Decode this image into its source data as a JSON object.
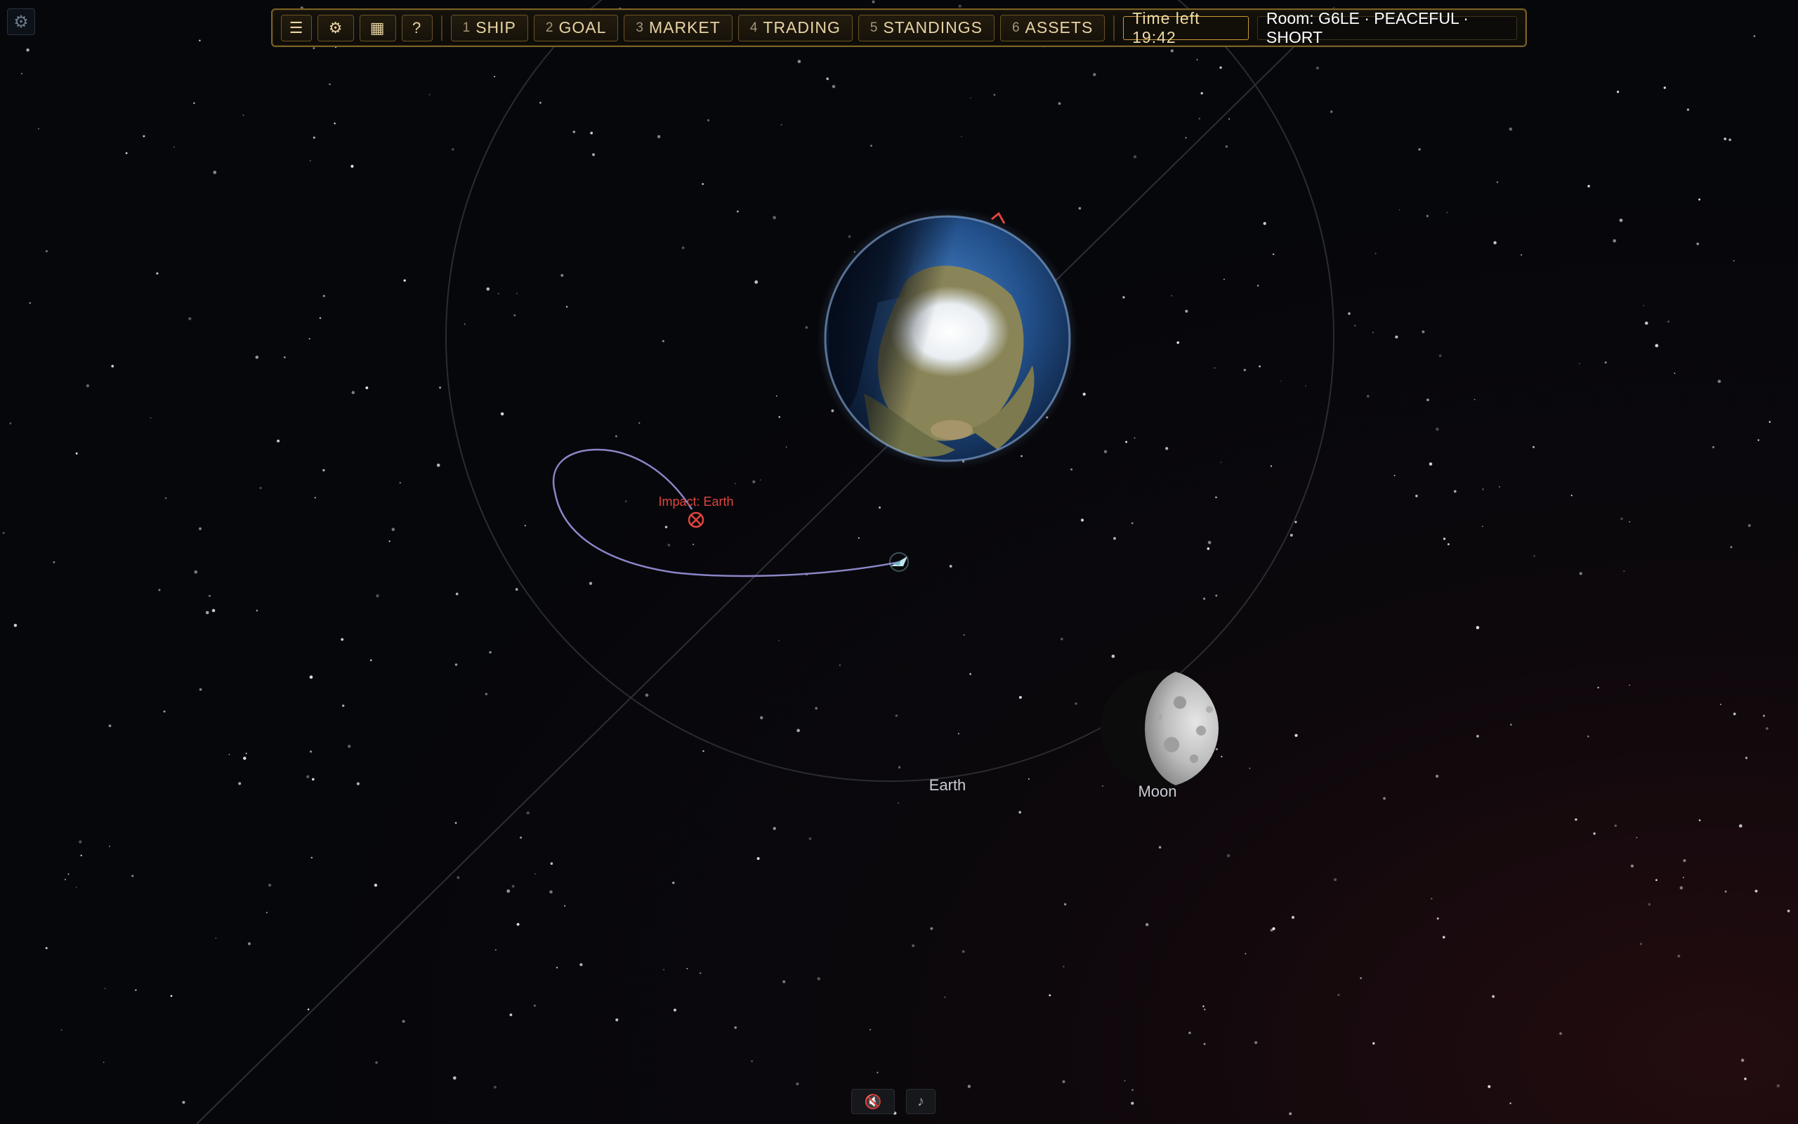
{
  "toolbar": {
    "menu_icon": "☰",
    "settings_icon": "⚙",
    "grid_icon": "▦",
    "help_icon": "?",
    "nav": [
      {
        "num": "1",
        "label": "SHIP"
      },
      {
        "num": "2",
        "label": "GOAL"
      },
      {
        "num": "3",
        "label": "MARKET"
      },
      {
        "num": "4",
        "label": "TRADING"
      },
      {
        "num": "5",
        "label": "STANDINGS"
      },
      {
        "num": "6",
        "label": "ASSETS"
      }
    ],
    "time_left": "Time left 19:42",
    "room": "Room: G6LE · PEACEFUL · SHORT"
  },
  "corner": {
    "settings_icon": "⚙"
  },
  "map": {
    "earth_label": "Earth",
    "moon_label": "Moon",
    "impact_label": "Impact: Earth"
  },
  "bottom": {
    "mute_icon": "🔇",
    "music_icon": "♪"
  },
  "colors": {
    "toolbar_border": "#7a6126",
    "toolbar_text": "#e7d3a4",
    "time_border": "#c79b3a",
    "impact_red": "#e0443f",
    "trajectory": "#8b86c7"
  }
}
